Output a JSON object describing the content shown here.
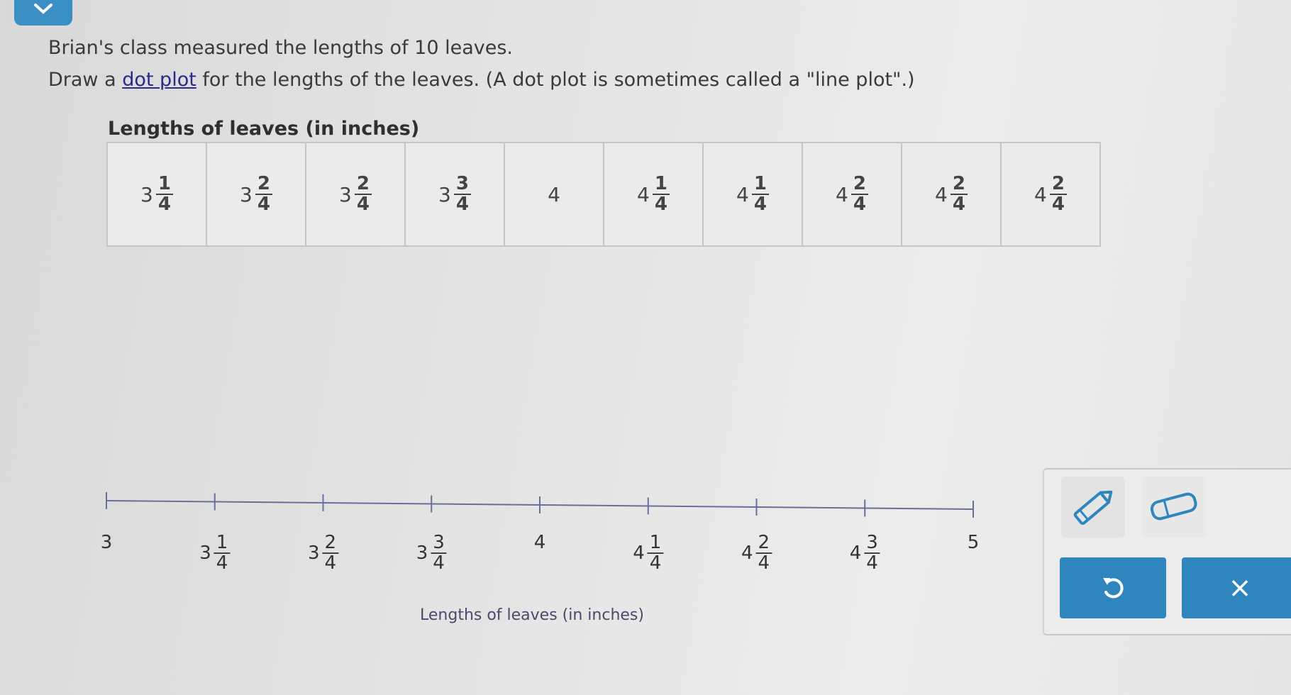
{
  "question": {
    "line1": "Brian's class measured the lengths of 10 leaves.",
    "line2_before": "Draw a ",
    "line2_link": "dot plot",
    "line2_after": " for the lengths of the leaves. (A dot plot is sometimes called a \"line plot\".)"
  },
  "table": {
    "title": "Lengths of leaves (in inches)",
    "values": [
      {
        "whole": "3",
        "num": "1",
        "den": "4"
      },
      {
        "whole": "3",
        "num": "2",
        "den": "4"
      },
      {
        "whole": "3",
        "num": "2",
        "den": "4"
      },
      {
        "whole": "3",
        "num": "3",
        "den": "4"
      },
      {
        "whole": "4",
        "num": "",
        "den": ""
      },
      {
        "whole": "4",
        "num": "1",
        "den": "4"
      },
      {
        "whole": "4",
        "num": "1",
        "den": "4"
      },
      {
        "whole": "4",
        "num": "2",
        "den": "4"
      },
      {
        "whole": "4",
        "num": "2",
        "den": "4"
      },
      {
        "whole": "4",
        "num": "2",
        "den": "4"
      }
    ]
  },
  "chart_data": {
    "type": "scatter",
    "title": "",
    "xlabel": "Lengths of leaves (in inches)",
    "xlim": [
      3,
      5
    ],
    "ticks": [
      3,
      3.25,
      3.5,
      3.75,
      4,
      4.25,
      4.5,
      4.75,
      5
    ],
    "tick_labels": [
      {
        "whole": "3",
        "num": "",
        "den": ""
      },
      {
        "whole": "3",
        "num": "1",
        "den": "4"
      },
      {
        "whole": "3",
        "num": "2",
        "den": "4"
      },
      {
        "whole": "3",
        "num": "3",
        "den": "4"
      },
      {
        "whole": "4",
        "num": "",
        "den": ""
      },
      {
        "whole": "4",
        "num": "1",
        "den": "4"
      },
      {
        "whole": "4",
        "num": "2",
        "den": "4"
      },
      {
        "whole": "4",
        "num": "3",
        "den": "4"
      },
      {
        "whole": "5",
        "num": "",
        "den": ""
      }
    ],
    "points": []
  },
  "tools": {
    "pencil_icon": "pencil-icon",
    "eraser_icon": "eraser-icon",
    "undo_icon": "undo-icon",
    "clear_icon": "close-icon",
    "clear_label": "×",
    "accent": "#2f86bf"
  }
}
